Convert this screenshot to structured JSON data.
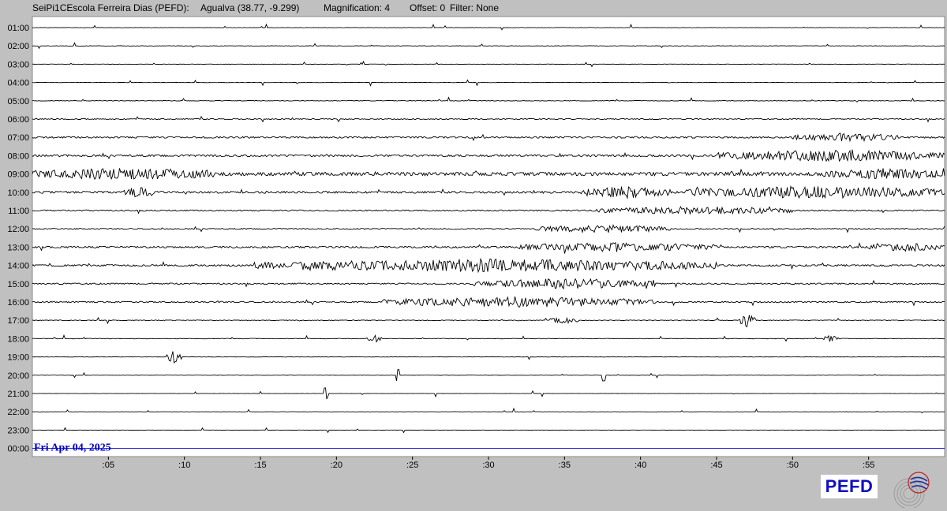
{
  "header": {
    "station": "SeiPi1CEscola Ferreira Dias (PEFD):",
    "location": "Agualva (38.77, -9.299)",
    "magnification": "Magnification: 4",
    "offset": "Offset: 0",
    "filter": "Filter: None"
  },
  "logo": {
    "text": "PEFD",
    "emblem": "seismograph-emblem-icon"
  },
  "chart_data": {
    "type": "line",
    "title": "",
    "date_label": "Fri Apr 04, 2025",
    "row_labels": [
      "01:00",
      "02:00",
      "03:00",
      "04:00",
      "05:00",
      "06:00",
      "07:00",
      "08:00",
      "09:00",
      "10:00",
      "11:00",
      "12:00",
      "13:00",
      "14:00",
      "15:00",
      "16:00",
      "17:00",
      "18:00",
      "19:00",
      "20:00",
      "21:00",
      "22:00",
      "23:00",
      "00:00"
    ],
    "x_ticks": [
      ":05",
      ":10",
      ":15",
      ":20",
      ":25",
      ":30",
      ":35",
      ":40",
      ":45",
      ":50",
      ":55"
    ],
    "xlim": [
      0,
      60
    ],
    "x_unit": "minutes",
    "activity": [
      {
        "row": "01:00",
        "level": 0.05
      },
      {
        "row": "02:00",
        "level": 0.05
      },
      {
        "row": "03:00",
        "level": 0.05
      },
      {
        "row": "04:00",
        "level": 0.05
      },
      {
        "row": "05:00",
        "level": 0.08
      },
      {
        "row": "06:00",
        "level": 0.15
      },
      {
        "row": "07:00",
        "level": 0.25,
        "bursts": [
          [
            50,
            57,
            0.6
          ]
        ]
      },
      {
        "row": "08:00",
        "level": 0.3,
        "bursts": [
          [
            45,
            60,
            0.8
          ]
        ]
      },
      {
        "row": "09:00",
        "level": 0.5,
        "bursts": [
          [
            0,
            12,
            0.8
          ],
          [
            52,
            60,
            0.7
          ]
        ]
      },
      {
        "row": "10:00",
        "level": 0.3,
        "bursts": [
          [
            36,
            42,
            0.9
          ],
          [
            43,
            60,
            0.9
          ],
          [
            6,
            8,
            0.8
          ]
        ]
      },
      {
        "row": "11:00",
        "level": 0.2,
        "bursts": [
          [
            37,
            50,
            0.6
          ]
        ]
      },
      {
        "row": "12:00",
        "level": 0.15,
        "bursts": [
          [
            33,
            42,
            0.6
          ]
        ]
      },
      {
        "row": "13:00",
        "level": 0.25,
        "bursts": [
          [
            32,
            45,
            0.7
          ],
          [
            55,
            60,
            0.6
          ]
        ]
      },
      {
        "row": "14:00",
        "level": 0.25,
        "bursts": [
          [
            14.5,
            45,
            1.0
          ]
        ]
      },
      {
        "row": "15:00",
        "level": 0.2,
        "bursts": [
          [
            29,
            41,
            0.8
          ]
        ]
      },
      {
        "row": "16:00",
        "level": 0.2,
        "bursts": [
          [
            23,
            41,
            0.8
          ]
        ]
      },
      {
        "row": "17:00",
        "level": 0.1,
        "bursts": [
          [
            46.5,
            47.5,
            1.0
          ],
          [
            34,
            36,
            0.5
          ]
        ]
      },
      {
        "row": "18:00",
        "level": 0.08,
        "bursts": [
          [
            22,
            23,
            0.6
          ],
          [
            52,
            53,
            0.5
          ]
        ]
      },
      {
        "row": "19:00",
        "level": 0.05,
        "bursts": [
          [
            8.8,
            9.8,
            1.0
          ]
        ]
      },
      {
        "row": "20:00",
        "level": 0.04,
        "spikes": [
          24,
          37.6
        ]
      },
      {
        "row": "21:00",
        "level": 0.04,
        "spikes": [
          19.3
        ]
      },
      {
        "row": "22:00",
        "level": 0.03
      },
      {
        "row": "23:00",
        "level": 0.03
      },
      {
        "row": "00:00",
        "level": 0.0,
        "color": "#0000cc"
      }
    ]
  }
}
